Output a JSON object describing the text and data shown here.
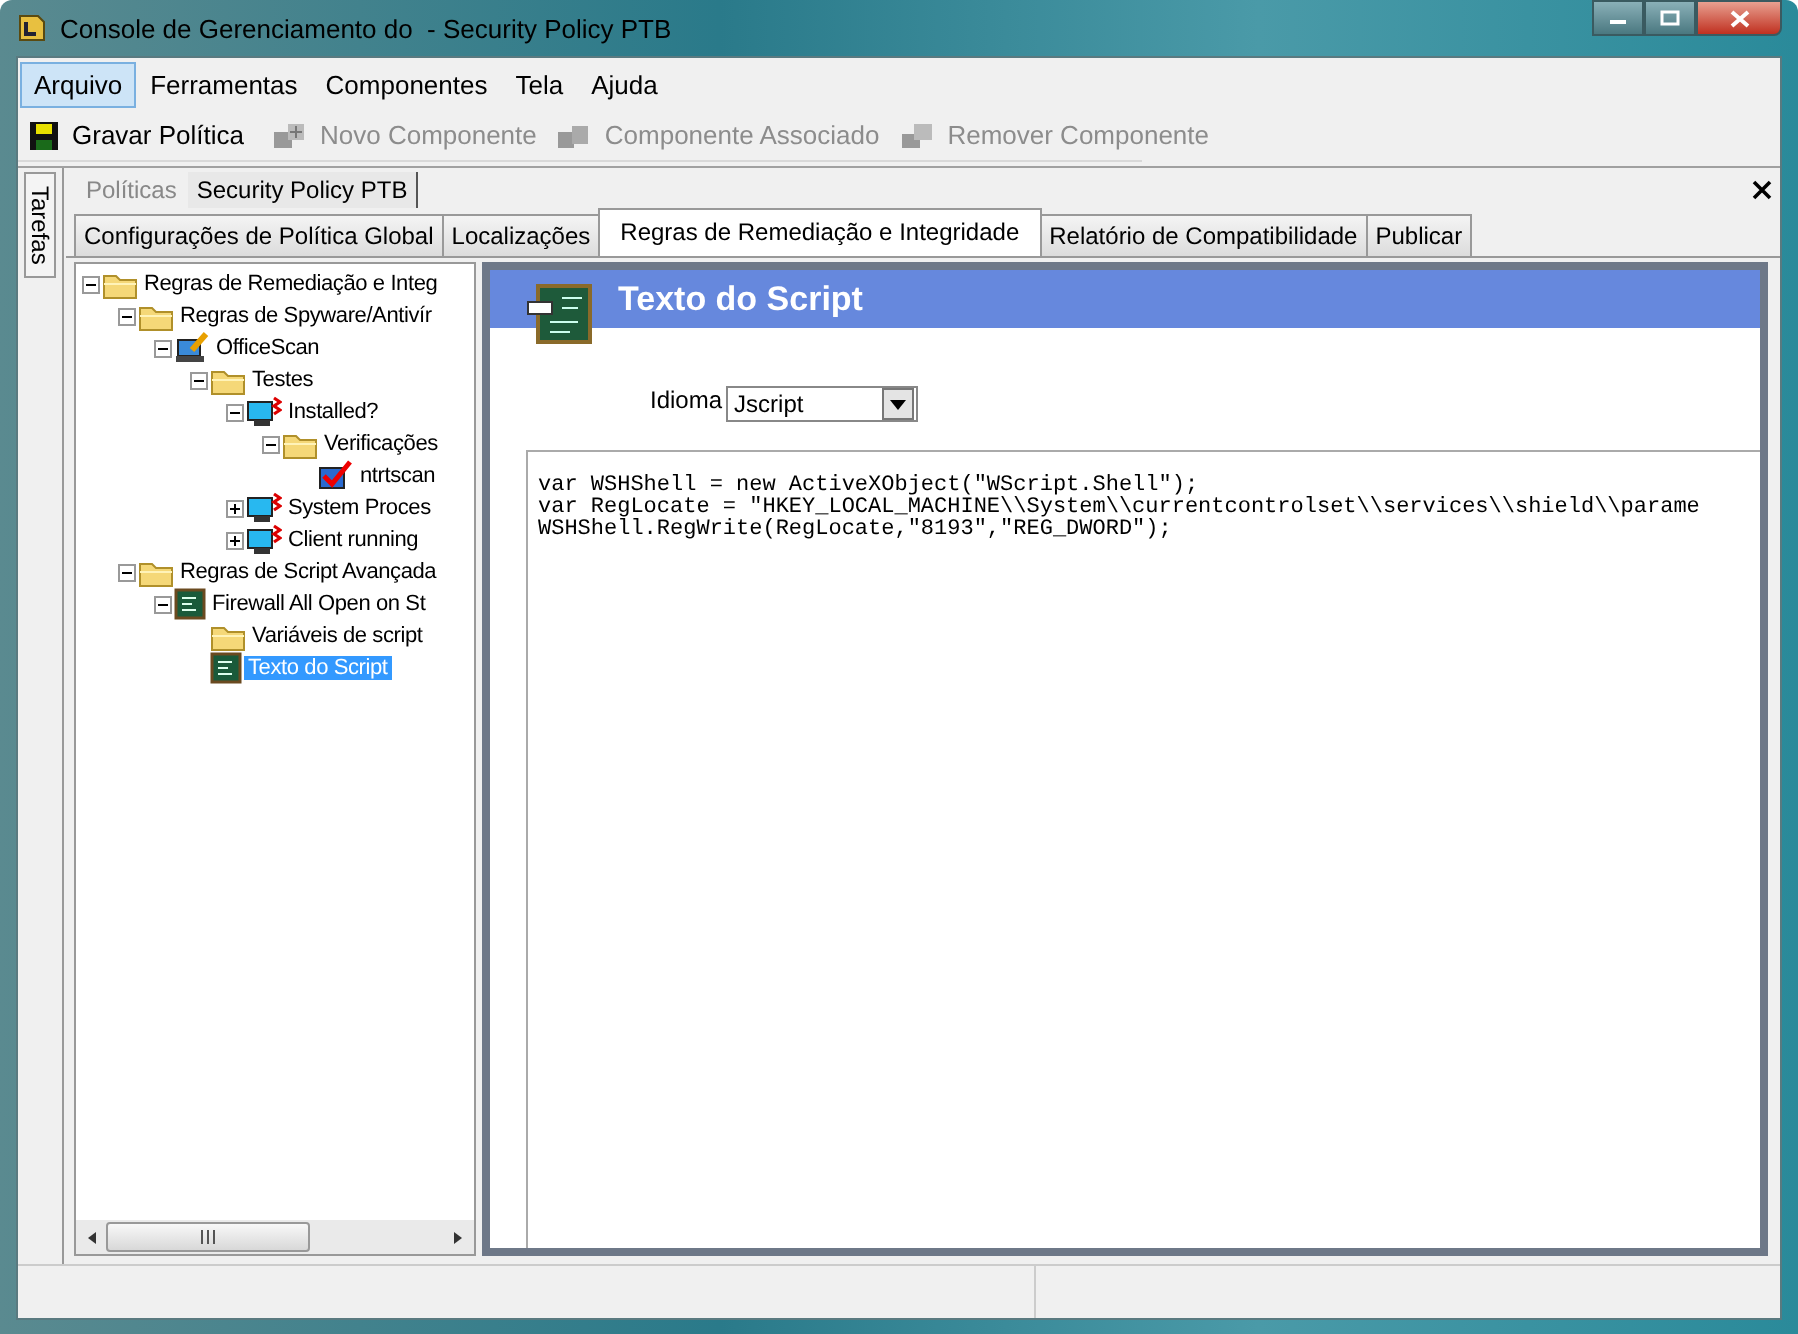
{
  "window": {
    "title": "Console de Gerenciamento do  - Security Policy PTB"
  },
  "menu": [
    {
      "label": "Arquivo",
      "selected": true
    },
    {
      "label": "Ferramentas",
      "selected": false
    },
    {
      "label": "Componentes",
      "selected": false
    },
    {
      "label": "Tela",
      "selected": false
    },
    {
      "label": "Ajuda",
      "selected": false
    }
  ],
  "toolbar": [
    {
      "label": "Gravar Política",
      "kind": "save",
      "disabled": false
    },
    {
      "label": "Novo Componente",
      "kind": "add",
      "disabled": true
    },
    {
      "label": "Componente Associado",
      "kind": "link",
      "disabled": true
    },
    {
      "label": "Remover Componente",
      "kind": "remove",
      "disabled": true
    }
  ],
  "side_tab": {
    "label": "Tarefas"
  },
  "doc_tabs": [
    {
      "label": "Políticas",
      "selected": false
    },
    {
      "label": "Security Policy PTB",
      "selected": true
    }
  ],
  "tabs": [
    {
      "label": "Configurações de Política Global",
      "selected": false
    },
    {
      "label": "Localizações",
      "selected": false
    },
    {
      "label": "Regras de Remediação e Integridade",
      "selected": true
    },
    {
      "label": "Relatório de Compatibilidade",
      "selected": false
    },
    {
      "label": "Publicar",
      "selected": false
    }
  ],
  "tree": [
    {
      "label": "Regras de Remediação e Integ",
      "kind": "folder",
      "expanded": true,
      "selected": false,
      "children": [
        {
          "label": "Regras de Spyware/Antivír",
          "kind": "folder",
          "expanded": true,
          "selected": false,
          "children": [
            {
              "label": "OfficeScan",
              "kind": "scan",
              "expanded": true,
              "selected": false,
              "children": [
                {
                  "label": "Testes",
                  "kind": "folder",
                  "expanded": true,
                  "selected": false,
                  "children": [
                    {
                      "label": "Installed?",
                      "kind": "monitor",
                      "expanded": true,
                      "selected": false,
                      "children": [
                        {
                          "label": "Verificações",
                          "kind": "folder",
                          "expanded": true,
                          "selected": false,
                          "children": [
                            {
                              "label": "ntrtscan",
                              "kind": "check",
                              "selected": false
                            }
                          ]
                        }
                      ]
                    },
                    {
                      "label": "System Proces",
                      "kind": "monitor",
                      "expanded": false,
                      "selected": false
                    },
                    {
                      "label": "Client running",
                      "kind": "monitor",
                      "expanded": false,
                      "selected": false
                    }
                  ]
                }
              ]
            }
          ]
        },
        {
          "label": "Regras de Script Avançada",
          "kind": "folder",
          "expanded": true,
          "selected": false,
          "children": [
            {
              "label": "Firewall All Open on St",
              "kind": "script",
              "expanded": true,
              "selected": false,
              "children": [
                {
                  "label": "Variáveis de script",
                  "kind": "folder",
                  "selected": false
                },
                {
                  "label": "Texto do Script",
                  "kind": "script",
                  "selected": true
                }
              ]
            }
          ]
        }
      ]
    }
  ],
  "panel": {
    "title": "Texto do Script",
    "language_label": "Idioma",
    "language": "Jscript",
    "code": [
      "var WSHShell = new ActiveXObject(\"WScript.Shell\");",
      "var RegLocate = \"HKEY_LOCAL_MACHINE\\\\System\\\\currentcontrolset\\\\services\\\\shield\\\\parame",
      "WSHShell.RegWrite(RegLocate,\"8193\",\"REG_DWORD\");"
    ]
  }
}
